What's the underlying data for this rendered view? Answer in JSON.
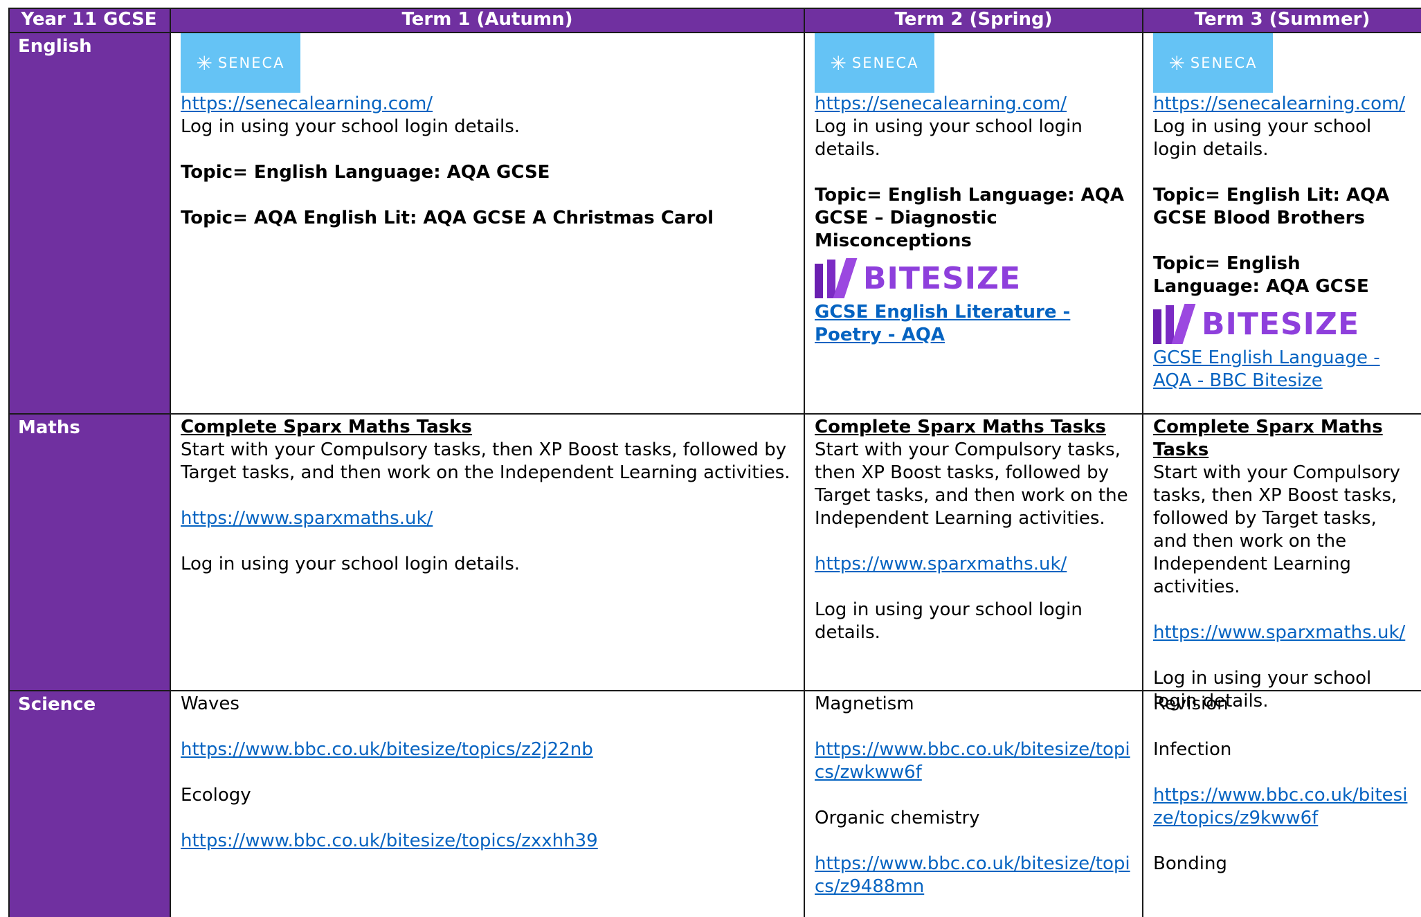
{
  "header": {
    "corner": "Year 11 GCSE",
    "term1": "Term 1 (Autumn)",
    "term2": "Term 2 (Spring)",
    "term3": "Term 3 (Summer)"
  },
  "rows": {
    "english": "English",
    "maths": "Maths",
    "science": "Science"
  },
  "seneca_logo_text": "SENECA",
  "bitesize_logo_text": "BITESIZE",
  "english": {
    "t1": {
      "link": "https://senecalearning.com/",
      "login": "Log in using your school login details.",
      "topic1": "Topic= English Language: AQA GCSE",
      "topic2": "Topic= AQA English Lit: AQA GCSE A Christmas Carol"
    },
    "t2": {
      "link": "https://senecalearning.com/",
      "login": "Log in using your school login details.",
      "topic1": "Topic= English Language: AQA GCSE – Diagnostic Misconceptions",
      "bitesize_link": "GCSE English Literature - Poetry - AQA"
    },
    "t3": {
      "link": "https://senecalearning.com/",
      "login": "Log in using your school login details.",
      "topic1": "Topic= English Lit: AQA GCSE Blood Brothers",
      "topic2": "Topic= English Language: AQA GCSE",
      "bitesize_link": "GCSE English Language - AQA - BBC Bitesize"
    }
  },
  "maths": {
    "title": "Complete Sparx Maths Tasks",
    "desc": "Start with your Compulsory tasks, then XP Boost tasks, followed by Target tasks, and then work on the Independent Learning activities.",
    "link": "https://www.sparxmaths.uk/",
    "login": "Log in using your school login details."
  },
  "science": {
    "t1": {
      "topic1": "Waves",
      "link1": "https://www.bbc.co.uk/bitesize/topics/z2j22nb",
      "topic2": "Ecology",
      "link2": "https://www.bbc.co.uk/bitesize/topics/zxxhh39"
    },
    "t2": {
      "topic1": "Magnetism",
      "link1": "https://www.bbc.co.uk/bitesize/topics/zwkww6f",
      "topic2": "Organic chemistry",
      "link2": "https://www.bbc.co.uk/bitesize/topics/z9488mn"
    },
    "t3": {
      "topic1": "Revision",
      "topic2": "Infection",
      "link2": "https://www.bbc.co.uk/bitesize/topics/z9kww6f",
      "topic3": "Bonding"
    }
  }
}
